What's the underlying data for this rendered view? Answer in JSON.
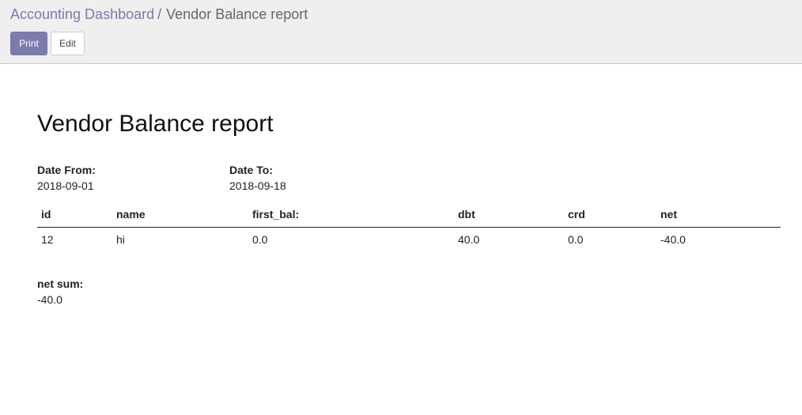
{
  "breadcrumb": {
    "parent": "Accounting Dashboard",
    "separator": "/",
    "current": "Vendor Balance report"
  },
  "toolbar": {
    "print_label": "Print",
    "edit_label": "Edit"
  },
  "colors": {
    "primary": "#7c7bad",
    "control_panel_bg": "#f0eeee"
  },
  "report": {
    "title": "Vendor Balance report",
    "date_from_label": "Date From:",
    "date_from_value": "2018-09-01",
    "date_to_label": "Date To:",
    "date_to_value": "2018-09-18",
    "table": {
      "headers": [
        "id",
        "name",
        "first_bal:",
        "dbt",
        "crd",
        "net"
      ],
      "rows": [
        [
          "12",
          "hi",
          "0.0",
          "40.0",
          "0.0",
          "-40.0"
        ]
      ]
    },
    "net_sum_label": "net sum:",
    "net_sum_value": "-40.0"
  }
}
